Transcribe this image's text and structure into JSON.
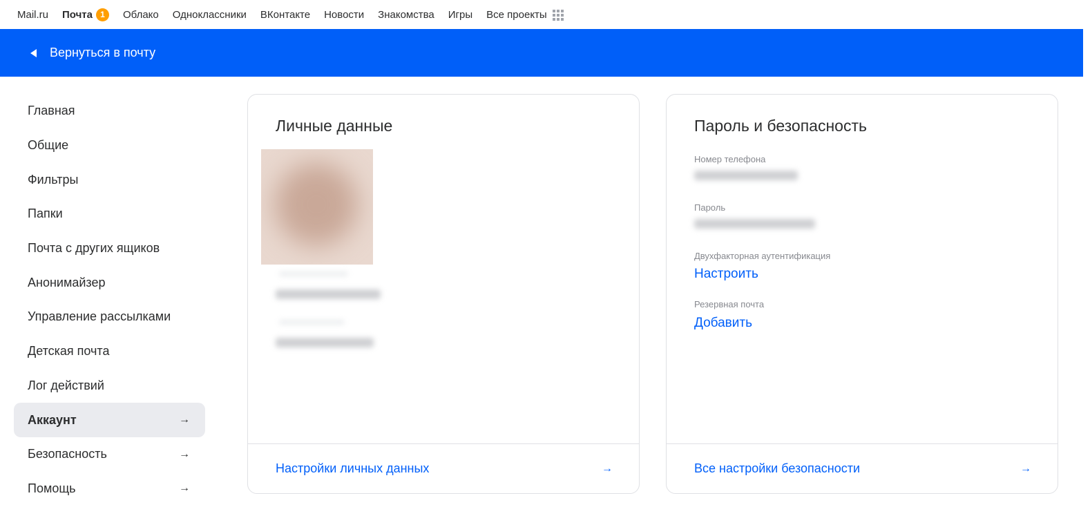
{
  "portal": {
    "items": [
      {
        "label": "Mail.ru"
      },
      {
        "label": "Почта",
        "badge": "1"
      },
      {
        "label": "Облако"
      },
      {
        "label": "Одноклассники"
      },
      {
        "label": "ВКонтакте"
      },
      {
        "label": "Новости"
      },
      {
        "label": "Знакомства"
      },
      {
        "label": "Игры"
      },
      {
        "label": "Все проекты",
        "icon": "apps-grid-icon"
      }
    ]
  },
  "header": {
    "back_label": "Вернуться в почту",
    "back_icon": "back-triangle-icon",
    "background": "#005ff9"
  },
  "sidebar": {
    "items": [
      {
        "label": "Главная"
      },
      {
        "label": "Общие"
      },
      {
        "label": "Фильтры"
      },
      {
        "label": "Папки"
      },
      {
        "label": "Почта с других ящиков"
      },
      {
        "label": "Анонимайзер"
      },
      {
        "label": "Управление рассылками"
      },
      {
        "label": "Детская почта"
      },
      {
        "label": "Лог действий"
      },
      {
        "label": "Аккаунт",
        "selected": true,
        "arrow": "→"
      },
      {
        "label": "Безопасность",
        "arrow": "→"
      },
      {
        "label": "Помощь",
        "arrow": "→"
      }
    ]
  },
  "personal": {
    "title": "Личные данные",
    "footer_link": "Настройки личных данных",
    "footer_arrow": "→"
  },
  "security": {
    "title": "Пароль и безопасность",
    "phone_label": "Номер телефона",
    "password_label": "Пароль",
    "twofa_label": "Двухфакторная аутентификация",
    "twofa_action": "Настроить",
    "backup_label": "Резервная почта",
    "backup_action": "Добавить",
    "footer_link": "Все настройки безопасности",
    "footer_arrow": "→"
  },
  "colors": {
    "accent": "#005ff9",
    "badge": "#ff9e00",
    "selected_bg": "#eaebef"
  }
}
